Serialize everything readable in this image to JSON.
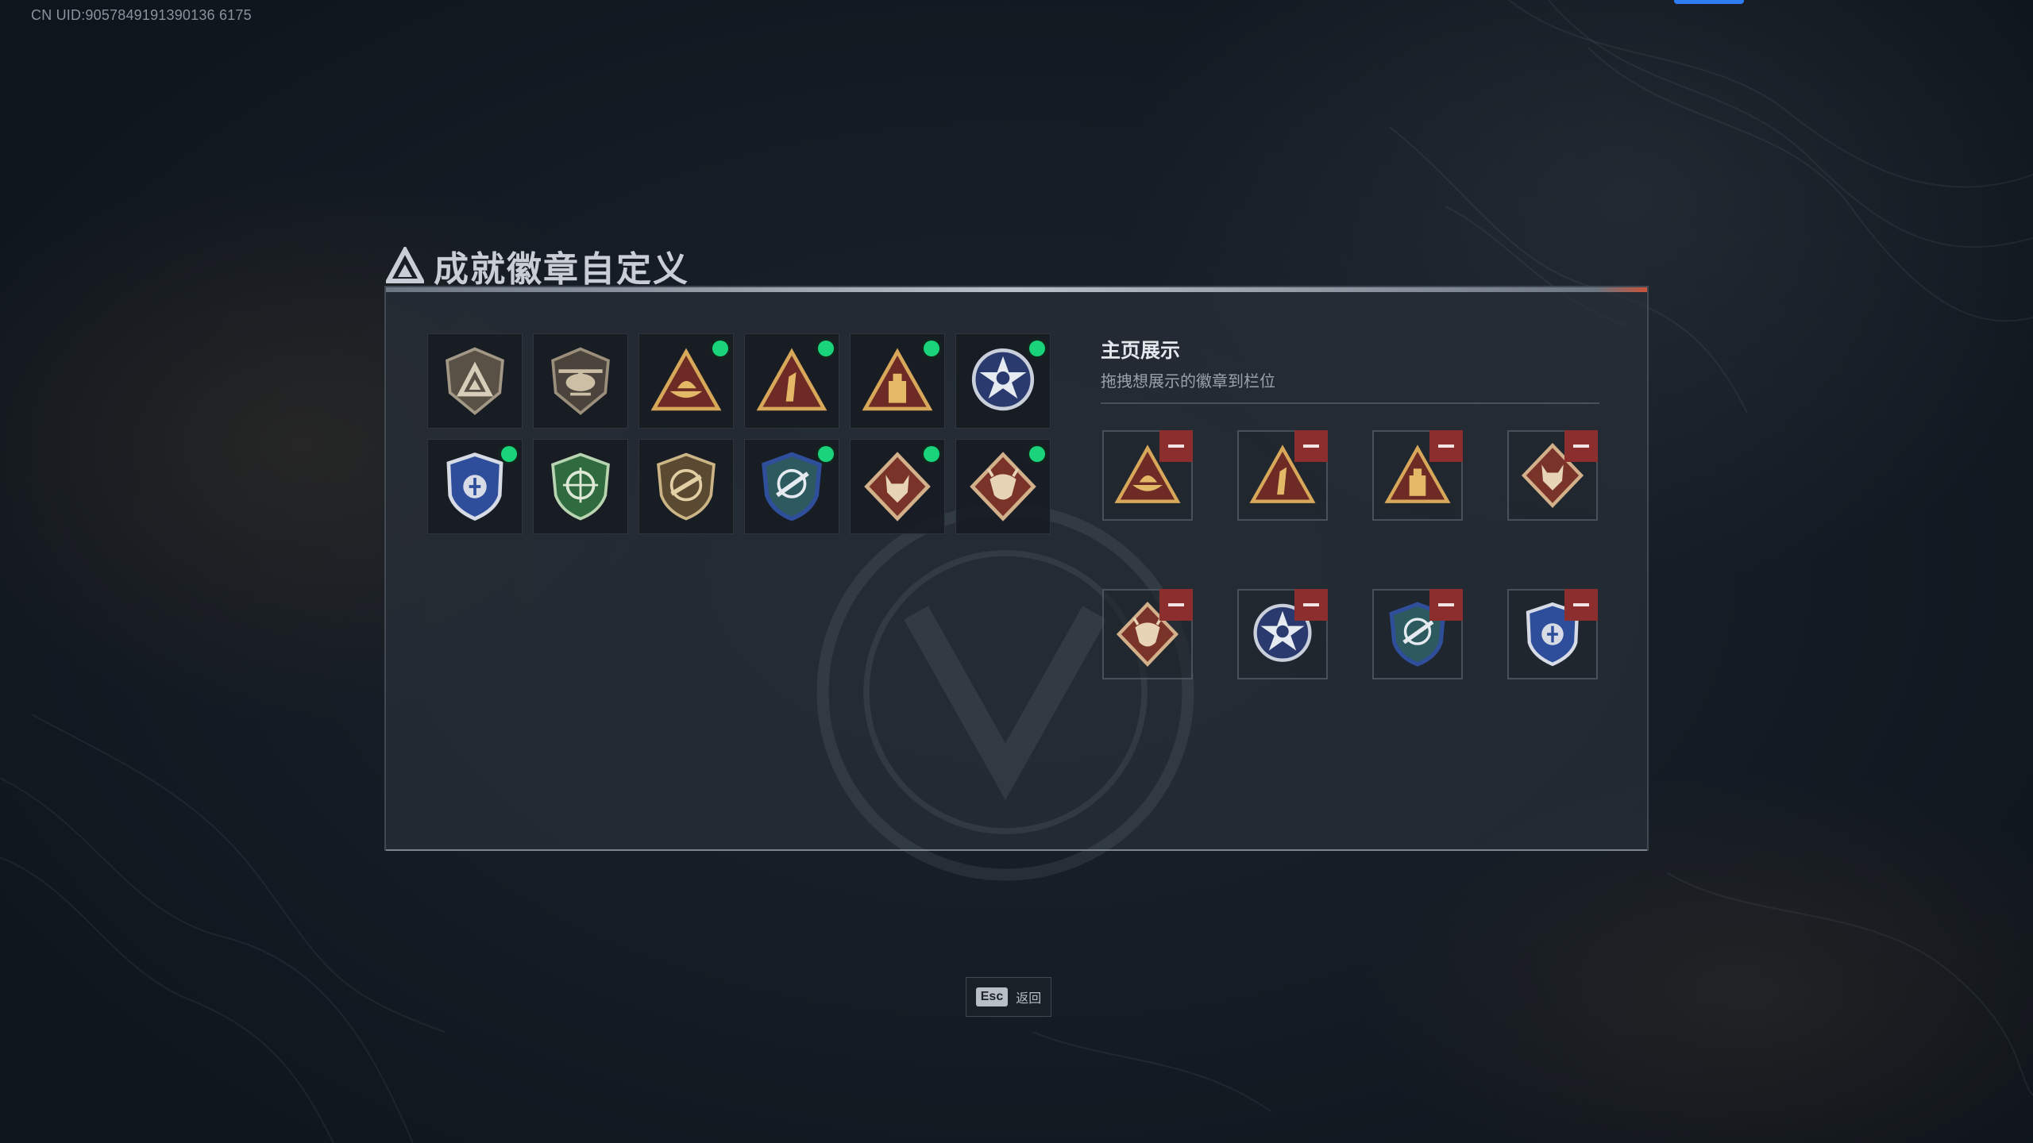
{
  "uid_text": "CN UID:9057849191390136 6175",
  "title": "成就徽章自定义",
  "collection": {
    "badges": [
      {
        "icon": "shield-triangle-badge-icon",
        "equipped": false
      },
      {
        "icon": "helicopter-shield-badge-icon",
        "equipped": false
      },
      {
        "icon": "boat-triangle-badge-icon",
        "equipped": true
      },
      {
        "icon": "number-one-triangle-badge-icon",
        "equipped": true
      },
      {
        "icon": "tower-triangle-badge-icon",
        "equipped": true
      },
      {
        "icon": "star-eagle-medal-icon",
        "equipped": true
      },
      {
        "icon": "blue-police-shield-icon",
        "equipped": true
      },
      {
        "icon": "green-crosshair-shield-icon",
        "equipped": false
      },
      {
        "icon": "tan-rifle-shield-icon",
        "equipped": false
      },
      {
        "icon": "green-blue-rifle-shield-icon",
        "equipped": true
      },
      {
        "icon": "wolf-diamond-badge-icon",
        "equipped": true
      },
      {
        "icon": "dragon-diamond-badge-icon",
        "equipped": true
      }
    ]
  },
  "showcase": {
    "title": "主页展示",
    "subtitle": "拖拽想展示的徽章到栏位",
    "slots": [
      {
        "icon": "boat-triangle-badge-icon"
      },
      {
        "icon": "number-one-triangle-badge-icon"
      },
      {
        "icon": "tower-triangle-badge-icon"
      },
      {
        "icon": "wolf-diamond-badge-icon"
      },
      {
        "icon": "dragon-diamond-badge-icon"
      },
      {
        "icon": "star-eagle-medal-icon"
      },
      {
        "icon": "green-blue-rifle-shield-icon"
      },
      {
        "icon": "blue-police-shield-icon"
      }
    ]
  },
  "footer": {
    "esc_key": "Esc",
    "esc_label": "返回"
  },
  "colors": {
    "equipped_dot": "#19d47a",
    "remove_button": "#8c2e2e",
    "accent_blue": "#2f7df2"
  }
}
